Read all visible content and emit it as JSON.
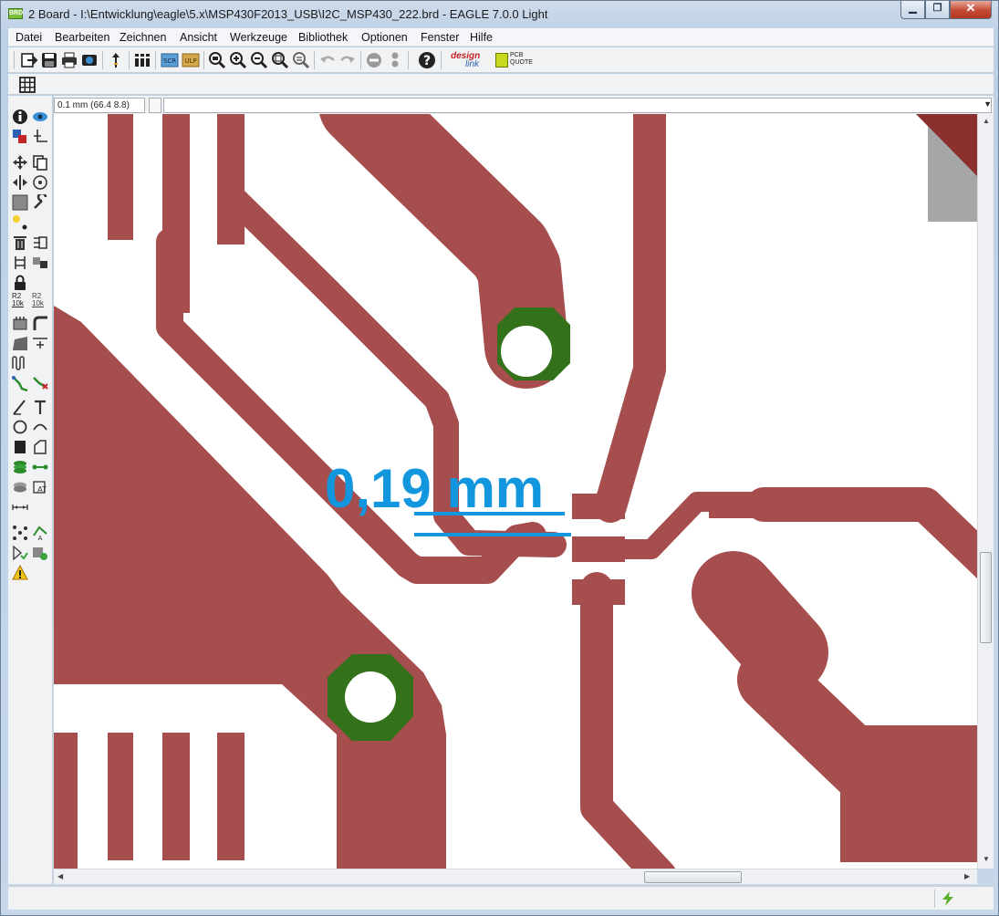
{
  "window": {
    "title": "2 Board - I:\\Entwicklung\\eagle\\5.x\\MSP430F2013_USB\\I2C_MSP430_222.brd - EAGLE 7.0.0 Light",
    "app_icon_text": "BRD"
  },
  "menu": [
    "Datei",
    "Bearbeiten",
    "Zeichnen",
    "Ansicht",
    "Werkzeuge",
    "Bibliothek",
    "Optionen",
    "Fenster",
    "Hilfe"
  ],
  "toolbar": {
    "icons": [
      "open-icon",
      "save-icon",
      "print-icon",
      "cam-icon",
      "upload-icon",
      "layer-stack-icon",
      "script-icon",
      "run-ulp-icon",
      "zoom-fit-icon",
      "zoom-in-icon",
      "zoom-out-icon",
      "zoom-redraw-icon",
      "zoom-area-icon",
      "undo-icon",
      "redo-icon",
      "stop-icon",
      "go-icon",
      "help-icon",
      "designlink-icon",
      "pcbquote-icon"
    ],
    "designlink_label_1": "design",
    "designlink_label_2": "link",
    "pcbquote_label_1": "PCB",
    "pcbquote_label_2": "QUOTE"
  },
  "toolbar2": {
    "icons": [
      "grid-icon"
    ]
  },
  "coords": {
    "display": "0.1 mm (66.4 8.8)",
    "command_value": ""
  },
  "palette": {
    "icons": [
      "info-icon",
      "show-icon",
      "display-layers-icon",
      "mark-icon",
      "move-icon",
      "copy-icon",
      "mirror-icon",
      "rotate-icon",
      "group-icon",
      "change-icon",
      "paste-icon",
      "delete-icon",
      "add-icon",
      "pinswap-icon",
      "replace-icon",
      "lock-icon",
      "name-icon",
      "value-icon",
      "smash-icon",
      "miter-icon",
      "split-icon",
      "optimize-icon",
      "meander-icon",
      "route-icon",
      "ripup-icon",
      "wire-icon",
      "text-icon",
      "circle-icon",
      "arc-icon",
      "rect-icon",
      "polygon-icon",
      "via-icon",
      "signal-icon",
      "hole-icon",
      "attribute-icon",
      "dimension-icon",
      "ratsnest-icon",
      "autorouter-icon",
      "drc-icon",
      "erc-icon",
      "errors-icon"
    ],
    "name_label": "R2",
    "name_sub": "10k"
  },
  "board": {
    "annotation_text": "0,19 mm",
    "colors": {
      "copper": "#a64d4d",
      "via": "#33711a",
      "annotation": "#1296dd",
      "grey_area": "#a6a6a6",
      "dark_copper": "#8b2f2f"
    }
  },
  "status": {
    "text": "",
    "run_icon": "lightning-icon"
  }
}
